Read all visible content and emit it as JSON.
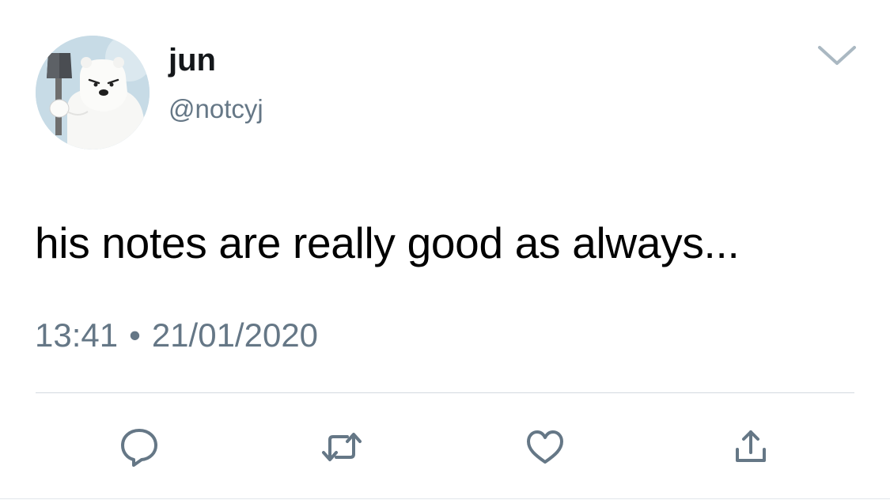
{
  "user": {
    "display_name": "jun",
    "handle": "@notcyj",
    "avatar": "polar-bear-avatar"
  },
  "tweet": {
    "text": "his notes are really good as always...",
    "time": "13:41",
    "separator": "•",
    "date": "21/01/2020"
  },
  "actions": [
    {
      "name": "reply",
      "icon": "reply-icon"
    },
    {
      "name": "retweet",
      "icon": "retweet-icon"
    },
    {
      "name": "like",
      "icon": "heart-icon"
    },
    {
      "name": "share",
      "icon": "share-icon"
    }
  ],
  "colors": {
    "text": "#14171a",
    "secondary": "#657786",
    "divider": "#d4dadf",
    "icon": "#657786"
  }
}
